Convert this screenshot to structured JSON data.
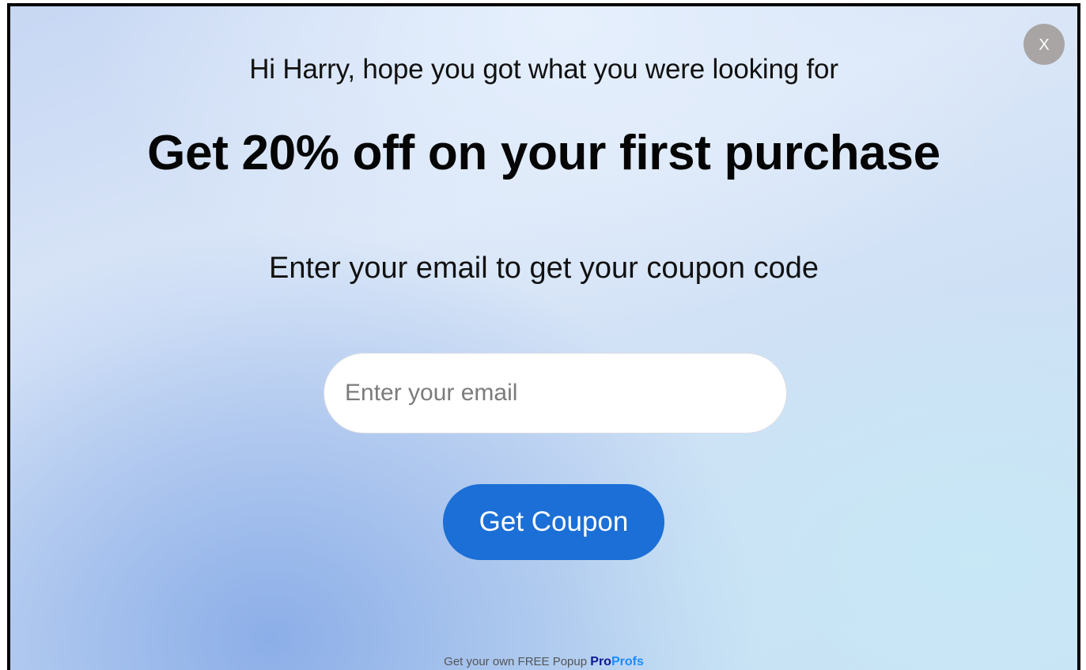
{
  "popup": {
    "close_label": "X",
    "greeting": "Hi Harry, hope you got what you were looking for",
    "headline": "Get 20% off on your first purchase",
    "prompt": "Enter your email to get your coupon code",
    "email_placeholder": "Enter your email",
    "email_value": "",
    "submit_label": "Get Coupon",
    "footer": {
      "text": "Get your own FREE Popup",
      "brand_part1": "Pro",
      "brand_part2": "Profs"
    }
  },
  "colors": {
    "button": "#1b6fd6",
    "close_button": "#a9a5a5",
    "brand_dark": "#0b1a8f",
    "brand_light": "#1a8cff"
  }
}
